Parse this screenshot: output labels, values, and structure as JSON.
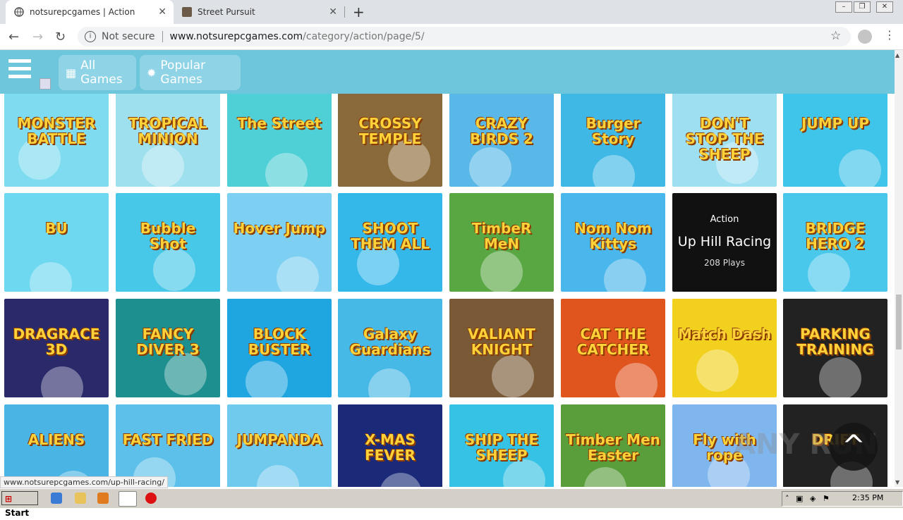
{
  "browser": {
    "tabs": [
      {
        "title": "notsurepcgames | Action"
      },
      {
        "title": "Street Pursuit"
      }
    ],
    "new_tab": "+",
    "security": "Not secure",
    "url_host": "www.notsurepcgames.com",
    "url_path": "/category/action/page/5/"
  },
  "header": {
    "nav": [
      {
        "label": "All Games",
        "icon": "grid-icon"
      },
      {
        "label": "Popular Games",
        "icon": "sparkle-icon"
      }
    ]
  },
  "games": [
    {
      "name": "MONSTER BATTLE",
      "color": "#7fdcf0"
    },
    {
      "name": "TROPICAL MINION",
      "color": "#9fe0ef"
    },
    {
      "name": "The Street",
      "color": "#4fd0d6"
    },
    {
      "name": "CROSSY TEMPLE",
      "color": "#8a6a3a"
    },
    {
      "name": "CRAZY BIRDS 2",
      "color": "#5ab8e8"
    },
    {
      "name": "Burger Story",
      "color": "#3fb8e6"
    },
    {
      "name": "DON'T STOP THE SHEEP",
      "color": "#9ee0f2"
    },
    {
      "name": "JUMP UP",
      "color": "#3fc4ea"
    },
    {
      "name": "BU",
      "color": "#6ed8f0"
    },
    {
      "name": "Bubble Shot",
      "color": "#48c8e8"
    },
    {
      "name": "Hover Jump",
      "color": "#7dd0f2"
    },
    {
      "name": "SHOOT THEM ALL",
      "color": "#34b8ea"
    },
    {
      "name": "TimbeR MeN",
      "color": "#59a743"
    },
    {
      "name": "Nom Nom Kittys",
      "color": "#49b6ec"
    },
    {
      "name": "Up Hill Racing",
      "color": "#111111"
    },
    {
      "name": "BRIDGE HERO 2",
      "color": "#49c8ec"
    },
    {
      "name": "DRAGRACE 3D",
      "color": "#2a2a6a"
    },
    {
      "name": "FANCY DIVER 3",
      "color": "#1e8f8f"
    },
    {
      "name": "BLOCK BUSTER",
      "color": "#1fa6e0"
    },
    {
      "name": "Galaxy Guardians",
      "color": "#47b9e6"
    },
    {
      "name": "VALIANT KNIGHT",
      "color": "#7a5a36"
    },
    {
      "name": "CAT THE CATCHER",
      "color": "#e0541e"
    },
    {
      "name": "Match Dash",
      "color": "#f2d11e"
    },
    {
      "name": "PARKING TRAINING",
      "color": "#222222"
    },
    {
      "name": "ALIENS",
      "color": "#4ab4e4"
    },
    {
      "name": "FAST FRIED",
      "color": "#5cc0ea"
    },
    {
      "name": "JUMPANDA",
      "color": "#6fcaee"
    },
    {
      "name": "X-MAS FEVER",
      "color": "#1a2a78"
    },
    {
      "name": "SHIP THE SHEEP",
      "color": "#36c2e4"
    },
    {
      "name": "Timber Men Easter",
      "color": "#5a9e3c"
    },
    {
      "name": "Fly with rope",
      "color": "#7fb6ee"
    },
    {
      "name": "DRIFT",
      "color": "#222222"
    }
  ],
  "hover_card": {
    "category": "Action",
    "title": "Up Hill Racing",
    "plays": "208 Plays"
  },
  "status_link": "www.notsurepcgames.com/up-hill-racing/",
  "watermark": "ANY RUN",
  "taskbar": {
    "start": "Start",
    "clock": "2:35 PM"
  }
}
